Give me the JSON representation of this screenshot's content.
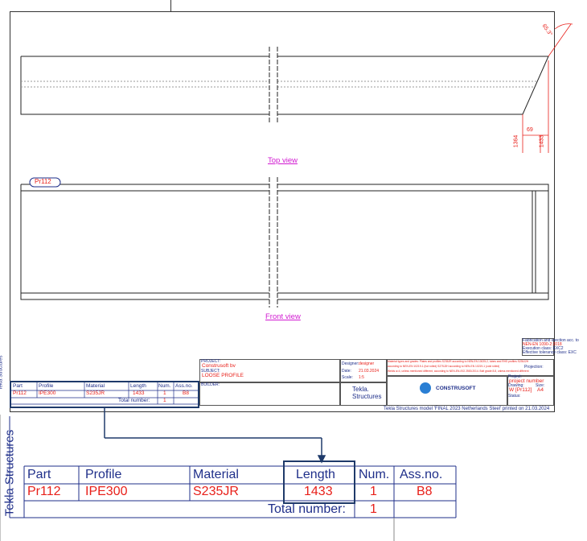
{
  "views": {
    "top_label": "Top view",
    "front_label": "Front view"
  },
  "dims": {
    "angle": "65.3°",
    "d69": "69",
    "d1364": "1364",
    "d1433": "1433"
  },
  "part_mark": "Pr112",
  "side_text": "Tekla Structures",
  "title_block": {
    "project_label": "PROJECT:",
    "project_value": "Construsoft bv",
    "subject_label": "SUBJECT:",
    "subject_value": "LOOSE PROFILE",
    "builder_label": "BUILDER:",
    "designer_label": "Designer:",
    "designer_value": "designer",
    "date_label": "Date:",
    "date_value": "21.03.2024",
    "scale_label": "Scale:",
    "scale_value": "1:5",
    "material_note_1": "Material types and grades: Plates and profiles S235JR according to NEN-EN 10025-2, tubes and RHS profiles S235J2H",
    "material_note_2": "according to NEN-EN 10219-1 (hot rolled) S275J2H according to NEN-EN 10219-1 (cold rolled)",
    "material_note_3": "Welds a=4, unless mentioned different, according to NEN-EN-ISO 2553:2014. Bolt grade 8.8, unless mentioned different",
    "projection_label": "Projection:",
    "project_no_label": "Project:",
    "project_no_value": "project number",
    "drawing_label": "Drawing:",
    "drawing_value": "W  [Pr112]",
    "size_label": "Size:",
    "size_value": "A4",
    "status_label": "Status:",
    "fab_1": "Fabrication and erection acc. to",
    "fab_2": "NEN-EN 1090-2:2018",
    "fab_3": "Execution class:  EXC2",
    "fab_4": "Effective tolerance class:  EXC",
    "tekla_logo_1": "Tekla.",
    "tekla_logo_2": "Structures",
    "construsoft_logo": "CONSTRUSOFT",
    "printed_by": "Tekla Structures  model 'FINAL 2023 Netherlands Steel' printed on 21.03.2024"
  },
  "parts_table": {
    "headers": [
      "Part",
      "Profile",
      "Material",
      "Length",
      "Num.",
      "Ass.no."
    ],
    "row": [
      "Pr112",
      "IPE300",
      "S235JR",
      "1433",
      "1",
      "B8"
    ],
    "total_label": "Total number:",
    "total_value": "1"
  }
}
